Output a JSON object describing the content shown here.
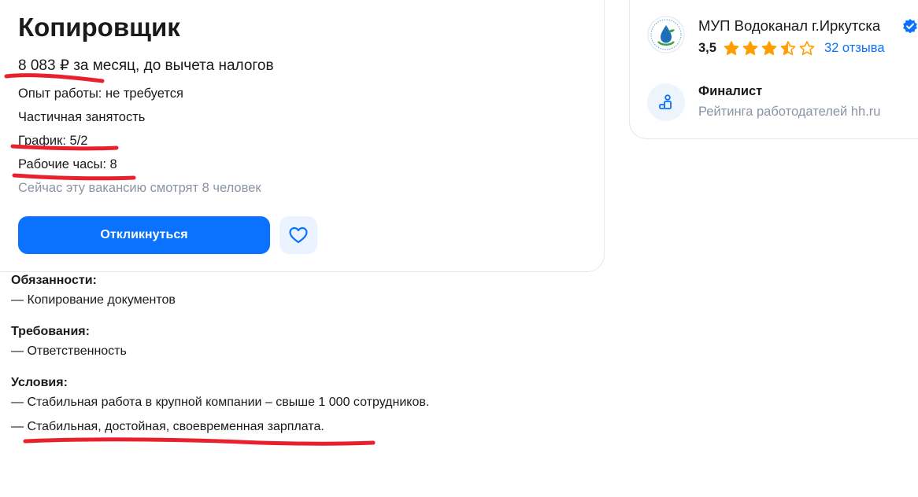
{
  "vacancy": {
    "title": "Копировщик",
    "salary": "8 083 ₽ за месяц, до вычета налогов",
    "experience": "Опыт работы: не требуется",
    "employment": "Частичная занятость",
    "schedule": "График: 5/2",
    "hours": "Рабочие часы: 8",
    "viewers": "Сейчас эту вакансию смотрят 8 человек",
    "apply_label": "Откликнуться"
  },
  "employer": {
    "name": "МУП Водоканал г.Иркутска",
    "rating": "3,5",
    "stars": 3.5,
    "reviews": "32 отзыва",
    "finalist_title": "Финалист",
    "finalist_subtitle": "Рейтинга работодателей hh.ru"
  },
  "description": {
    "duties_heading": "Обязанности:",
    "duties_item": "— Копирование документов",
    "requirements_heading": "Требования:",
    "requirements_item": "— Ответственность",
    "conditions_heading": "Условия:",
    "conditions_item_1": "— Стабильная работа в крупной компании – свыше 1 000 сотрудников.",
    "conditions_item_2": "— Стабильная, достойная, своевременная зарплата."
  },
  "colors": {
    "accent": "#0a72ff",
    "star": "#ff9e00",
    "annotation": "#e8212c",
    "muted": "#8a94a3"
  }
}
